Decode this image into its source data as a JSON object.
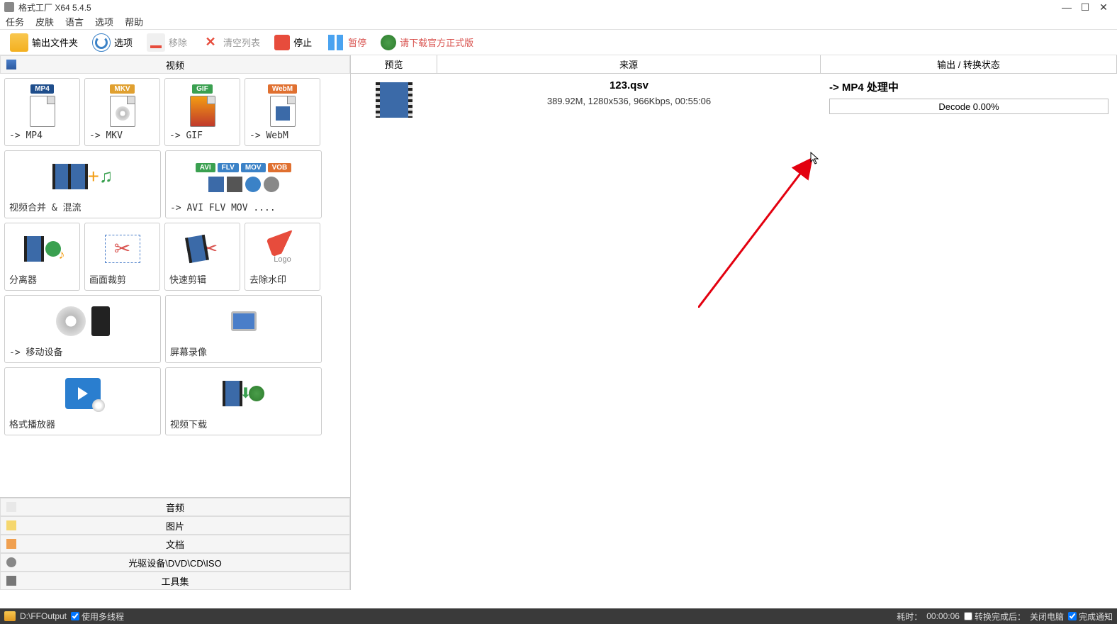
{
  "window": {
    "title": "格式工厂 X64 5.4.5"
  },
  "menu": {
    "task": "任务",
    "skin": "皮肤",
    "language": "语言",
    "options": "选项",
    "help": "帮助"
  },
  "toolbar": {
    "output_folder": "输出文件夹",
    "options": "选项",
    "remove": "移除",
    "clear_list": "清空列表",
    "stop": "停止",
    "pause": "暂停",
    "download_link": "请下载官方正式版"
  },
  "sections": {
    "video": "视频",
    "audio": "音频",
    "image": "图片",
    "document": "文档",
    "disc": "光驱设备\\DVD\\CD\\ISO",
    "tools": "工具集"
  },
  "tiles": {
    "mp4": "-> MP4",
    "mkv": "-> MKV",
    "gif": "-> GIF",
    "webm": "-> WebM",
    "merge": "视频合并 & 混流",
    "avi_etc": "-> AVI FLV MOV ....",
    "separator": "分离器",
    "crop": "画面裁剪",
    "quickcut": "快速剪辑",
    "watermark": "去除水印",
    "mobile": "-> 移动设备",
    "screenrec": "屏幕录像",
    "player": "格式播放器",
    "download": "视频下载",
    "logo_text": "Logo"
  },
  "list": {
    "headers": {
      "preview": "预览",
      "source": "来源",
      "status": "输出 / 转换状态"
    },
    "row": {
      "filename": "123.qsv",
      "info": "389.92M, 1280x536, 966Kbps, 00:55:06",
      "target": "-> MP4 处理中",
      "progress": "Decode 0.00%"
    }
  },
  "statusbar": {
    "output_path": "D:\\FFOutput",
    "multithread": "使用多线程",
    "elapsed_label": "耗时：",
    "elapsed_time": "00:00:06",
    "after_label": "转换完成后：",
    "shutdown": "关闭电脑",
    "notify": "完成通知"
  }
}
